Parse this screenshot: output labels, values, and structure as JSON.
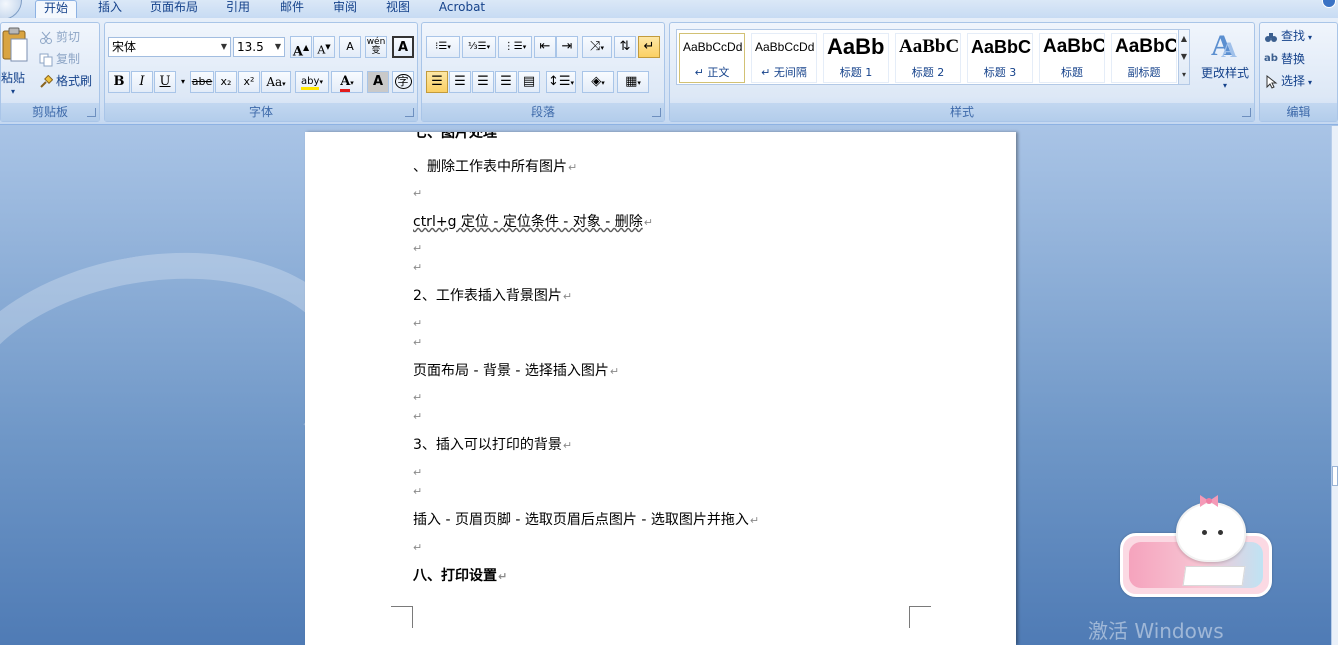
{
  "tabs": [
    "开始",
    "插入",
    "页面布局",
    "引用",
    "邮件",
    "审阅",
    "视图",
    "Acrobat"
  ],
  "active_tab": "开始",
  "clipboard": {
    "paste": "粘贴",
    "cut": "剪切",
    "copy": "复制",
    "format_painter": "格式刷",
    "group_label": "剪贴板"
  },
  "font": {
    "name": "宋体",
    "size": "13.5",
    "group_label": "字体",
    "grow_label": "A",
    "shrink_label": "A",
    "bold": "B",
    "italic": "I",
    "underline": "U",
    "strike": "abe",
    "subscript": "x₂",
    "superscript": "x²",
    "change_case": "Aa",
    "phonetic": "wén",
    "phonetic_sub": "变",
    "highlight": "aby",
    "font_color": "A",
    "char_shading": "A",
    "enclosed": "字",
    "clear_format": "A"
  },
  "paragraph": {
    "group_label": "段落"
  },
  "styles": {
    "group_label": "样式",
    "items": [
      {
        "sample": "AaBbCcDd",
        "name": "↵ 正文"
      },
      {
        "sample": "AaBbCcDd",
        "name": "↵ 无间隔"
      },
      {
        "sample": "AaBb",
        "name": "标题 1"
      },
      {
        "sample": "AaBbC",
        "name": "标题 2"
      },
      {
        "sample": "AaBbC",
        "name": "标题 3"
      },
      {
        "sample": "AaBbC",
        "name": "标题"
      },
      {
        "sample": "AaBbC",
        "name": "副标题"
      }
    ],
    "change_styles": "更改样式"
  },
  "editing": {
    "group_label": "编辑",
    "find": "查找",
    "replace": "替换",
    "select": "选择"
  },
  "document": {
    "lines": [
      "、删除工作表中所有图片",
      "ctrl+g 定位 - 定位条件 - 对象 - 删除",
      "2、工作表插入背景图片",
      "页面布局 - 背景 - 选择插入图片",
      "3、插入可以打印的背景",
      "插入 - 页眉页脚 - 选取页眉后点图片 - 选取图片并拖入",
      "八、打印设置"
    ],
    "para_mark": "↵"
  },
  "watermark": "激活 Windows",
  "colors": {
    "ribbon_bg": "#dde8f6",
    "accent": "#15428b",
    "page_bg": "#ffffff",
    "workspace": "#6f97c7"
  }
}
